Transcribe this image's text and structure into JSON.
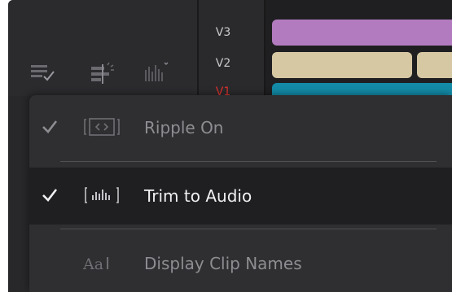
{
  "tracks": {
    "v3": "V3",
    "v2": "V2",
    "v1": "V1"
  },
  "toolbar": {
    "tools": [
      {
        "icon": "track-destination-check-icon"
      },
      {
        "icon": "snapping-icon"
      },
      {
        "icon": "audio-waveform-dropdown-icon"
      }
    ]
  },
  "clips": [
    {
      "track": "V3",
      "color": "#b37bbf"
    },
    {
      "track": "V2",
      "color": "#d7c8a4"
    },
    {
      "track": "V1",
      "color": "#138aa6"
    }
  ],
  "menu": {
    "items": [
      {
        "label": "Ripple On",
        "checked": true,
        "selected": false,
        "icon": "ripple-icon"
      },
      {
        "label": "Trim to Audio",
        "checked": true,
        "selected": true,
        "icon": "audio-waveform-icon"
      },
      {
        "label": "Display Clip Names",
        "checked": false,
        "selected": false,
        "icon": "text-aa-icon"
      }
    ]
  },
  "colors": {
    "background": "#28282b",
    "menu_bg": "#2f2f32",
    "menu_selected_bg": "#1f1f22",
    "accent_red": "#d8322c"
  }
}
